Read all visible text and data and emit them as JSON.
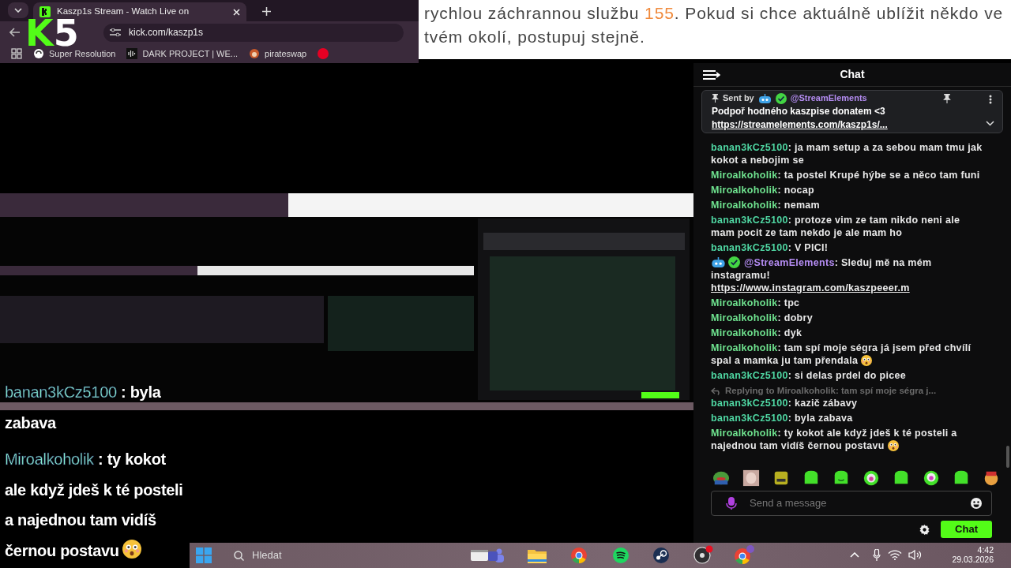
{
  "browser": {
    "tab_title": "Kaszp1s Stream - Watch Live on",
    "address": "kick.com/kaszp1s",
    "bookmarks": [
      {
        "label": "Super Resolution"
      },
      {
        "label": "DARK PROJECT | WE..."
      },
      {
        "label": "pirateswap"
      }
    ]
  },
  "logo": {
    "letter": "K",
    "digit": "5"
  },
  "notice": {
    "before": "rychlou záchrannou službu ",
    "highlight": "155",
    "after": ". Pokud si chce aktuálně ublížit někdo ve tvém okolí, postupuj stejně."
  },
  "video": {
    "kind": "picture",
    "overlay": [
      {
        "user": "banan3kCz5100",
        "color": "#86f0cf",
        "text": ": byla zabava",
        "emoji": false
      },
      {
        "user": "Miroalkoholik",
        "color": "#86f0cf",
        "text": ": ty kokot ale když jdeš k té posteli a najednou tam vidíš černou postavu",
        "emoji": true
      }
    ]
  },
  "chat": {
    "title": "Chat",
    "pinned": {
      "sent_by": "Sent by",
      "user": "@StreamElements",
      "text": "Podpoř hodného kaszpise donatem <3",
      "link": "https://streamelements.com/kaszp1s/..."
    },
    "messages": [
      {
        "kind": "message",
        "user": "banan3kCz5100",
        "color": "#4fd6a2",
        "text": ": ja mam setup a za sebou mam tmu jak kokot a nebojim se",
        "emoji": false
      },
      {
        "kind": "message",
        "user": "Miroalkoholik",
        "color": "#6fe38f",
        "text": ": ta postel Krupé hýbe se a něco tam funi",
        "emoji": false
      },
      {
        "kind": "message",
        "user": "Miroalkoholik",
        "color": "#6fe38f",
        "text": ": nocap",
        "emoji": false
      },
      {
        "kind": "message",
        "user": "Miroalkoholik",
        "color": "#6fe38f",
        "text": ": nemam",
        "emoji": false
      },
      {
        "kind": "message",
        "user": "banan3kCz5100",
        "color": "#4fd6a2",
        "text": ": protoze vim ze tam nikdo neni ale mam pocit ze tam nekdo je ale mam ho",
        "emoji": false
      },
      {
        "kind": "message",
        "user": "banan3kCz5100",
        "color": "#4fd6a2",
        "text": ": V PICI!",
        "emoji": false
      },
      {
        "kind": "bot",
        "user": "@StreamElements",
        "color": "#b48cf2",
        "text": ": Sleduj mě na mém instagramu!",
        "link": "https://www.instagram.com/kaszpeeer.m",
        "emoji": false
      },
      {
        "kind": "message",
        "user": "Miroalkoholik",
        "color": "#6fe38f",
        "text": ": tpc",
        "emoji": false
      },
      {
        "kind": "message",
        "user": "Miroalkoholik",
        "color": "#6fe38f",
        "text": ": dobry",
        "emoji": false
      },
      {
        "kind": "message",
        "user": "Miroalkoholik",
        "color": "#6fe38f",
        "text": ": dyk",
        "emoji": false
      },
      {
        "kind": "message",
        "user": "Miroalkoholik",
        "color": "#6fe38f",
        "text": ": tam spí moje ségra já jsem před chvílí spal a mamka ju tam přendala",
        "emoji": true
      },
      {
        "kind": "message",
        "user": "banan3kCz5100",
        "color": "#4fd6a2",
        "text": ": si delas prdel do picee",
        "emoji": false
      },
      {
        "kind": "reply",
        "text": "Replying to Miroalkoholik: tam spí moje ségra j..."
      },
      {
        "kind": "message",
        "user": "banan3kCz5100",
        "color": "#4fd6a2",
        "text": ": kazič zábavy",
        "emoji": false
      },
      {
        "kind": "message",
        "user": "banan3kCz5100",
        "color": "#4fd6a2",
        "text": ": byla zabava",
        "emoji": false
      },
      {
        "kind": "message",
        "user": "Miroalkoholik",
        "color": "#6fe38f",
        "text": ": ty kokot ale když jdeš k té posteli a najednou tam vidíš černou postavu",
        "emoji": true
      }
    ],
    "input": {
      "placeholder": "Send a message"
    },
    "send": "Chat"
  },
  "taskbar": {
    "search": {
      "placeholder": "Hledat"
    },
    "time": "4:42",
    "date": "29.03.2026"
  }
}
